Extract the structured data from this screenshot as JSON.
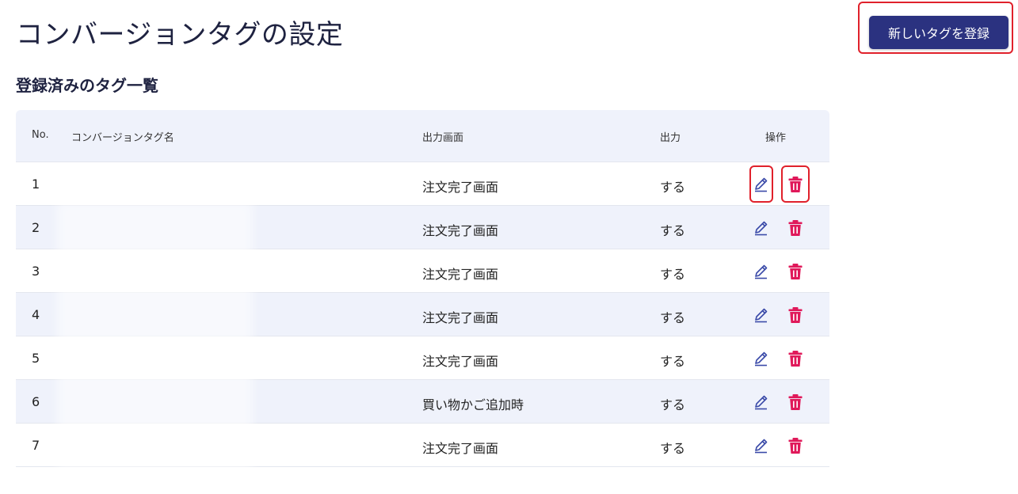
{
  "page": {
    "title": "コンバージョンタグの設定"
  },
  "header": {
    "register_label": "新しいタグを登録"
  },
  "section": {
    "title": "登録済みのタグ一覧"
  },
  "table": {
    "columns": [
      "No.",
      "コンバージョンタグ名",
      "出力画面",
      "出力",
      "操作"
    ],
    "rows": [
      {
        "no": "1",
        "name": "",
        "screen": "注文完了画面",
        "output": "する"
      },
      {
        "no": "2",
        "name": "",
        "screen": "注文完了画面",
        "output": "する"
      },
      {
        "no": "3",
        "name": "",
        "screen": "注文完了画面",
        "output": "する"
      },
      {
        "no": "4",
        "name": "",
        "screen": "注文完了画面",
        "output": "する"
      },
      {
        "no": "5",
        "name": "",
        "screen": "注文完了画面",
        "output": "する"
      },
      {
        "no": "6",
        "name": "",
        "screen": "買い物かご追加時",
        "output": "する"
      },
      {
        "no": "7",
        "name": "",
        "screen": "注文完了画面",
        "output": "する"
      }
    ]
  },
  "icons": {
    "edit": "pencil-icon",
    "delete": "trash-icon"
  },
  "colors": {
    "primary": "#2b3280",
    "edit_icon": "#3a4aa8",
    "delete_icon": "#e0195a",
    "highlight": "#e0212b"
  }
}
